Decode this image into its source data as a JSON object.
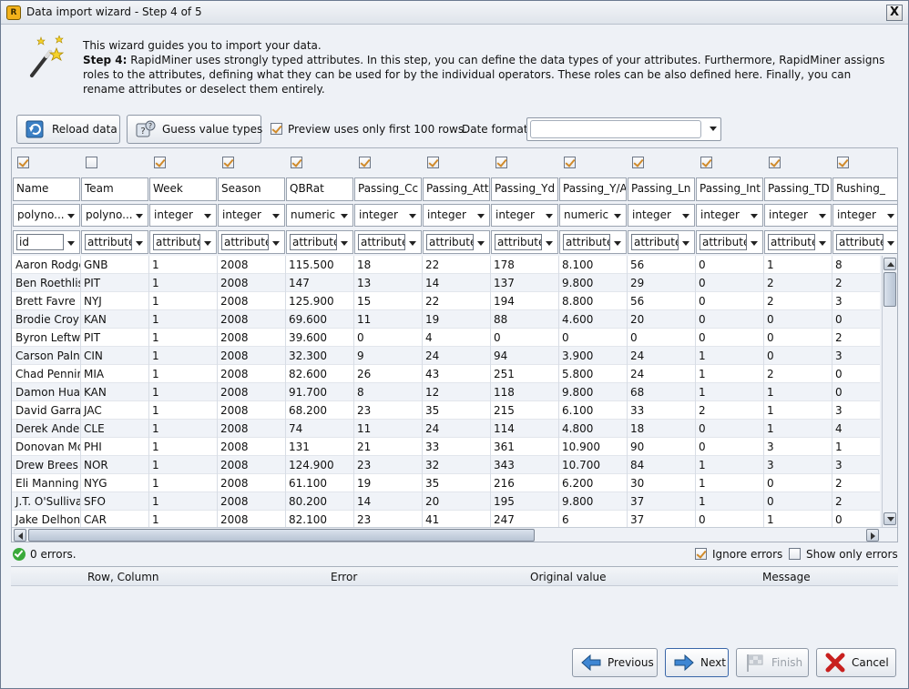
{
  "window": {
    "title": "Data import wizard - Step 4 of 5",
    "close_label": "X"
  },
  "intro": {
    "line1": "This wizard guides you to import your data.",
    "step_label": "Step 4:",
    "step_text": " RapidMiner uses strongly typed attributes. In this step, you can define the data types of your attributes. Furthermore, RapidMiner assigns roles to the attributes, defining what they can be used for by the individual operators. These roles can be also defined here. Finally, you can rename attributes or deselect them entirely."
  },
  "toolbar": {
    "reload_label": "Reload data",
    "guess_label": "Guess value types",
    "preview_label": "Preview uses only first 100 rows.",
    "preview_checked": true,
    "date_format_label": "Date format",
    "date_format_value": ""
  },
  "columns": [
    {
      "name": "Name",
      "type": "polyno...",
      "role": "id",
      "selected": true
    },
    {
      "name": "Team",
      "type": "polyno...",
      "role": "attribute",
      "selected": false
    },
    {
      "name": "Week",
      "type": "integer",
      "role": "attribute",
      "selected": true
    },
    {
      "name": "Season",
      "type": "integer",
      "role": "attribute",
      "selected": true
    },
    {
      "name": "QBRat",
      "type": "numeric",
      "role": "attribute",
      "selected": true
    },
    {
      "name": "Passing_Cc",
      "type": "integer",
      "role": "attribute",
      "selected": true
    },
    {
      "name": "Passing_Att",
      "type": "integer",
      "role": "attribute",
      "selected": true
    },
    {
      "name": "Passing_Yd",
      "type": "integer",
      "role": "attribute",
      "selected": true
    },
    {
      "name": "Passing_Y/A",
      "type": "numeric",
      "role": "attribute",
      "selected": true
    },
    {
      "name": "Passing_Ln",
      "type": "integer",
      "role": "attribute",
      "selected": true
    },
    {
      "name": "Passing_Int",
      "type": "integer",
      "role": "attribute",
      "selected": true
    },
    {
      "name": "Passing_TD",
      "type": "integer",
      "role": "attribute",
      "selected": true
    },
    {
      "name": "Rushing_",
      "type": "integer",
      "role": "attribute",
      "selected": true
    }
  ],
  "rows": [
    [
      "Aaron Rodge",
      "GNB",
      "1",
      "2008",
      "115.500",
      "18",
      "22",
      "178",
      "8.100",
      "56",
      "0",
      "1",
      "8"
    ],
    [
      "Ben Roethlis",
      "PIT",
      "1",
      "2008",
      "147",
      "13",
      "14",
      "137",
      "9.800",
      "29",
      "0",
      "2",
      "2"
    ],
    [
      "Brett Favre",
      "NYJ",
      "1",
      "2008",
      "125.900",
      "15",
      "22",
      "194",
      "8.800",
      "56",
      "0",
      "2",
      "3"
    ],
    [
      "Brodie Croyl",
      "KAN",
      "1",
      "2008",
      "69.600",
      "11",
      "19",
      "88",
      "4.600",
      "20",
      "0",
      "0",
      "0"
    ],
    [
      "Byron Leftwi",
      "PIT",
      "1",
      "2008",
      "39.600",
      "0",
      "4",
      "0",
      "0",
      "0",
      "0",
      "0",
      "2"
    ],
    [
      "Carson Paln",
      "CIN",
      "1",
      "2008",
      "32.300",
      "9",
      "24",
      "94",
      "3.900",
      "24",
      "1",
      "0",
      "3"
    ],
    [
      "Chad Pennir",
      "MIA",
      "1",
      "2008",
      "82.600",
      "26",
      "43",
      "251",
      "5.800",
      "24",
      "1",
      "2",
      "0"
    ],
    [
      "Damon Hua",
      "KAN",
      "1",
      "2008",
      "91.700",
      "8",
      "12",
      "118",
      "9.800",
      "68",
      "1",
      "1",
      "0"
    ],
    [
      "David Garrar",
      "JAC",
      "1",
      "2008",
      "68.200",
      "23",
      "35",
      "215",
      "6.100",
      "33",
      "2",
      "1",
      "3"
    ],
    [
      "Derek Ander",
      "CLE",
      "1",
      "2008",
      "74",
      "11",
      "24",
      "114",
      "4.800",
      "18",
      "0",
      "1",
      "4"
    ],
    [
      "Donovan Mc",
      "PHI",
      "1",
      "2008",
      "131",
      "21",
      "33",
      "361",
      "10.900",
      "90",
      "0",
      "3",
      "1"
    ],
    [
      "Drew Brees",
      "NOR",
      "1",
      "2008",
      "124.900",
      "23",
      "32",
      "343",
      "10.700",
      "84",
      "1",
      "3",
      "3"
    ],
    [
      "Eli Manning",
      "NYG",
      "1",
      "2008",
      "61.100",
      "19",
      "35",
      "216",
      "6.200",
      "30",
      "1",
      "0",
      "2"
    ],
    [
      "J.T. O'Sulliva",
      "SFO",
      "1",
      "2008",
      "80.200",
      "14",
      "20",
      "195",
      "9.800",
      "37",
      "1",
      "0",
      "2"
    ],
    [
      "Jake Delhon",
      "CAR",
      "1",
      "2008",
      "82.100",
      "23",
      "41",
      "247",
      "6",
      "37",
      "0",
      "1",
      "0"
    ]
  ],
  "status": {
    "errors_text": "0 errors.",
    "ignore_label": "Ignore errors",
    "ignore_checked": true,
    "only_label": "Show only errors",
    "only_checked": false
  },
  "error_table": {
    "headers": [
      "Row, Column",
      "Error",
      "Original value",
      "Message"
    ]
  },
  "footer": {
    "previous_label": "Previous",
    "next_label": "Next",
    "finish_label": "Finish",
    "cancel_label": "Cancel"
  }
}
